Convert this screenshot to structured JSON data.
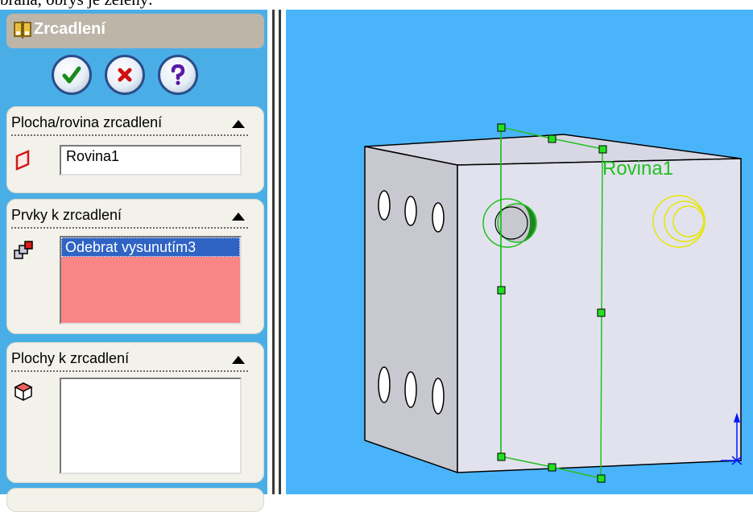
{
  "caption": {
    "text": "brána, obrys je zelený."
  },
  "property_manager": {
    "title": "Zrcadlení",
    "header_icon": "mirror-feature-icon",
    "buttons": [
      {
        "name": "ok-button",
        "icon": "check-icon",
        "color": "#1a8a1a"
      },
      {
        "name": "cancel-button",
        "icon": "x-icon",
        "color": "#d01010"
      },
      {
        "name": "help-button",
        "icon": "question-icon",
        "color": "#5a1aa8"
      }
    ],
    "groups": [
      {
        "title": "Plocha/rovina zrcadlení",
        "icon": "plane-icon",
        "value": "Rovina1"
      },
      {
        "title": "Prvky k zrcadlení",
        "icon": "features-icon",
        "items": [
          "Odebrat vysunutím3"
        ]
      },
      {
        "title": "Plochy k zrcadlení",
        "icon": "face-icon",
        "items": []
      }
    ],
    "colors": {
      "panel": "#4aaee6",
      "selection": "#2f63c4",
      "list_pink": "#f98686"
    }
  },
  "viewport": {
    "plane_label": "Rovina1",
    "colors": {
      "background": "#4ab4fa",
      "plane": "#22c022",
      "mirror_preview": "#e6e600",
      "body_front": "#e2e2ee",
      "body_side": "#c8c8d0",
      "body_top": "#d8d8e4"
    }
  }
}
